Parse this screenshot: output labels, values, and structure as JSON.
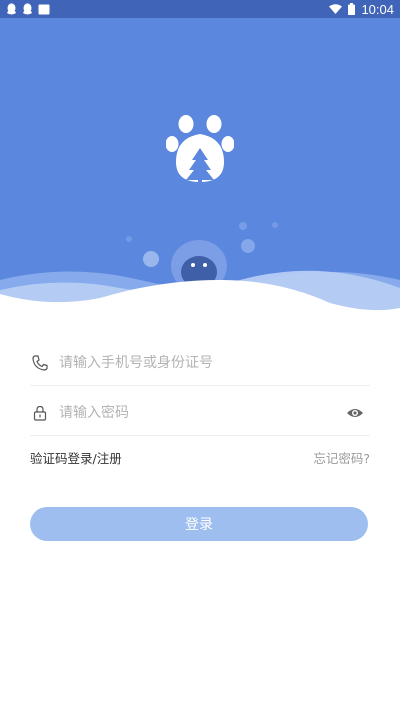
{
  "status_bar": {
    "time": "10:04",
    "icons": [
      "qq-icon",
      "qq-icon",
      "message-icon",
      "wifi-icon",
      "battery-icon"
    ]
  },
  "hero": {
    "logo": "paw-logo-icon",
    "background_color": "#5b87de"
  },
  "form": {
    "account": {
      "placeholder": "请输入手机号或身份证号",
      "value": "",
      "icon": "phone-icon"
    },
    "password": {
      "placeholder": "请输入密码",
      "value": "",
      "icon": "lock-icon",
      "toggle_icon": "eye-icon"
    },
    "sms_login_link": "验证码登录/注册",
    "forgot_password_link": "忘记密码?",
    "login_button": "登录"
  },
  "colors": {
    "primary": "#5b87de",
    "button": "#9ebeef",
    "status_bar": "#3f64b8"
  }
}
